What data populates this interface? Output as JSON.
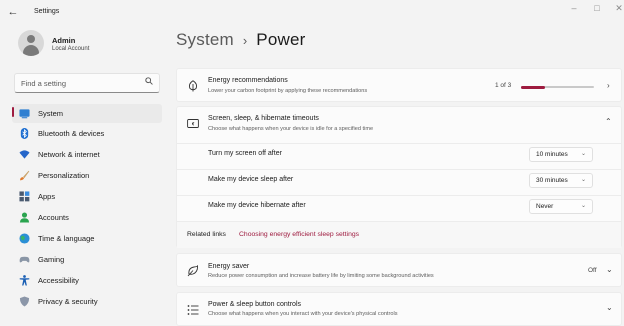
{
  "window": {
    "title": "Settings",
    "controls": [
      "minimize-icon",
      "maximize-icon",
      "close-icon"
    ]
  },
  "account": {
    "name": "Admin",
    "type": "Local Account"
  },
  "search": {
    "placeholder": "Find a setting",
    "icon": "search-icon"
  },
  "nav": {
    "selected": "System",
    "accent_color": "#9e1b3f",
    "items": [
      {
        "label": "System",
        "icon": "system-icon"
      },
      {
        "label": "Bluetooth & devices",
        "icon": "bluetooth-icon"
      },
      {
        "label": "Network & internet",
        "icon": "network-icon"
      },
      {
        "label": "Personalization",
        "icon": "brush-icon"
      },
      {
        "label": "Apps",
        "icon": "apps-icon"
      },
      {
        "label": "Accounts",
        "icon": "accounts-icon"
      },
      {
        "label": "Time & language",
        "icon": "globe-icon"
      },
      {
        "label": "Gaming",
        "icon": "gamepad-icon"
      },
      {
        "label": "Accessibility",
        "icon": "accessibility-icon"
      },
      {
        "label": "Privacy & security",
        "icon": "shield-icon"
      }
    ]
  },
  "header": {
    "parent": "System",
    "separator": "›",
    "current": "Power"
  },
  "energy": {
    "title": "Energy recommendations",
    "subtitle": "Lower your carbon footprint by applying these recommendations",
    "count": "1 of 3",
    "progress": 0.33,
    "icon": "leaf-icon"
  },
  "screen_sleep": {
    "title": "Screen, sleep, & hibernate timeouts",
    "subtitle": "Choose what happens when your device is idle for a specified time",
    "icon": "screen-sleep-icon",
    "settings": [
      {
        "label": "Turn my screen off after",
        "value": "10 minutes"
      },
      {
        "label": "Make my device sleep after",
        "value": "30 minutes"
      },
      {
        "label": "Make my device hibernate after",
        "value": "Never"
      }
    ]
  },
  "related": {
    "label": "Related links",
    "link": "Choosing energy efficient sleep settings"
  },
  "energy_saver": {
    "title": "Energy saver",
    "subtitle": "Reduce power consumption and increase battery life by limiting some background activities",
    "state": "Off",
    "icon": "energy-saver-icon"
  },
  "power_buttons": {
    "title": "Power & sleep button controls",
    "subtitle": "Choose what happens when you interact with your device's physical controls",
    "icon": "power-buttons-icon"
  }
}
